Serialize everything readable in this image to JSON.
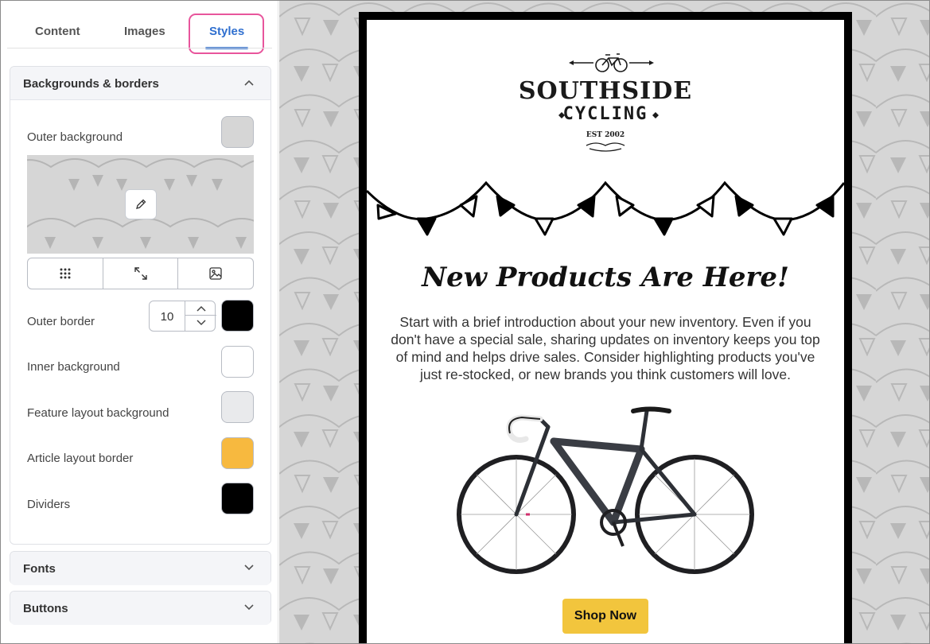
{
  "tabs": [
    {
      "label": "Content"
    },
    {
      "label": "Images"
    },
    {
      "label": "Styles",
      "active": true
    }
  ],
  "sections": {
    "backgrounds": {
      "title": "Backgrounds & borders",
      "expanded": true,
      "outer_background": {
        "label": "Outer background",
        "color": "#d6d6d6"
      },
      "outer_border": {
        "label": "Outer border",
        "width_value": "10",
        "color": "#000000"
      },
      "inner_background": {
        "label": "Inner background",
        "color": "#ffffff"
      },
      "feature_layout_background": {
        "label": "Feature layout background",
        "color": "#e9eaec"
      },
      "article_layout_border": {
        "label": "Article layout border",
        "color": "#f7b93f"
      },
      "dividers": {
        "label": "Dividers",
        "color": "#000000"
      }
    },
    "fonts": {
      "title": "Fonts",
      "expanded": false
    },
    "buttons": {
      "title": "Buttons",
      "expanded": false
    }
  },
  "image_tools": [
    "tile-icon",
    "expand-icon",
    "image-icon"
  ],
  "email": {
    "logo": {
      "name": "SOUTHSIDE",
      "sub": "CYCLING",
      "est": "EST 2002"
    },
    "headline": "New Products Are Here!",
    "body": "Start with a brief introduction about your new inventory. Even if you don't have a special sale, sharing updates on inventory keeps you top of mind and helps drive sales. Consider highlighting products you've just re-stocked, or new brands you think customers will love.",
    "button_label": "Shop Now",
    "button_color": "#f2c53d"
  },
  "colors": {
    "accent": "#2f6fcf",
    "tab_highlight": "#e8559c"
  }
}
